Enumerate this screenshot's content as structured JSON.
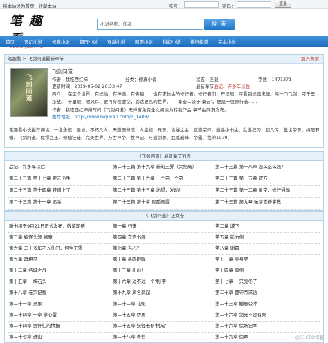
{
  "topbar": {
    "links": [
      "将本站设为首页",
      "收藏本站"
    ],
    "account_label": "账号：",
    "password_label": "密码：",
    "login_button": "登录"
  },
  "logo": {
    "text": "笔 趣 看",
    "domain": "www.biqukan.com"
  },
  "search": {
    "placeholder": "小说名称、作者",
    "button": "搜 索"
  },
  "nav": [
    "首页",
    "玄幻小说",
    "修真小说",
    "都市小说",
    "穿越小说",
    "网游小说",
    "科幻小说",
    "排行榜单",
    "完本小说"
  ],
  "breadcrumb": {
    "home": "笔趣看",
    "sep": " > ",
    "current": "飞剑问道最新章节",
    "add_bookshelf": "加入书架"
  },
  "book": {
    "title": "飞剑问道",
    "cover_text": "飞剑问道",
    "author": "作者：我吃西红柿",
    "category": "分类：修真小说",
    "status": "状态：连载",
    "words": "字数：1471371",
    "updated": "更新时间：2019-05-02 20:33:47",
    "latest_label": "最新章节：",
    "latest": "后记、许多年以后",
    "desc": "简介：　在这个世界，有妖仙，有神魔，有佛祖……也有求长生的修行者。修行者们，开法眼，可看到妖魔鬼怪。练一口飞剑，可千里杀敌。　千里眼、顺风耳、更可穿梭虚空，到达更高的世界。　　秦宏二公子‘秦云’，便是一位修行者……",
    "intro_line1": "作者：我吃西红柿所写的《飞剑问道》无弹窗免费全文阅读为转载作品,章节由网友发布。",
    "intro_line2": "推荐地址：http://www.biqukan.com/1_1408/"
  },
  "related": "笔趣看小说推荐阅读：一念永恒、圣墟、不朽凡人、天道图书馆、人皇纪、元尊、诡秘之主、武道宗师、逍遥小书生、乱世狂刀、超凡传、盖世帝尊、纯阳邪僧、飞剑问道、保镖之王、修仙狂徒、完美世界、万古神帝、牧神记、万道剑尊、武炼巅峰、帝霸、我的1979、",
  "latest_section": {
    "title": "《飞剑问道》最新章节列表",
    "rows": [
      [
        "后记、许多年以后",
        "第二十三篇 第十九章 新的三界（大结局）",
        "第二十三篇 第十八章 怎么这么强？"
      ],
      [
        "第二十三篇 第十七章 要云出手",
        "第二十三篇 第十六章 一个弟一个弟",
        "第二十三篇 第十五章 双方"
      ],
      [
        "第二十三篇 第十四章 铁道上了",
        "第二十三篇 第十三章 坊望，发动！",
        "第二十三篇 第十二章 星空，修行通局"
      ],
      [
        "第二十三篇 第十一章 追杀",
        "第二十三篇 第十章 星孤离雷",
        "第二十三篇 第九章 破涉宫新掌教"
      ]
    ]
  },
  "main_section": {
    "title": "《飞剑问道》正文卷",
    "rows": [
      [
        "新书将于9月21日正式发布，敬请期待！",
        "第一章 归来",
        "第二章 城下"
      ],
      [
        "第三章 妖怪头领 猪魔",
        "第四章 东宫书阁",
        "第五章 新力剑"
      ],
      [
        "第六章 二十多年不入仙门，何生无望",
        "第七章 当心？",
        "第八章 谢霜"
      ],
      [
        "第九章 再相见",
        "第十章 杀鸣眼眸",
        "第十一章 卖身契"
      ],
      [
        "第十二章 名城之战",
        "第十三章 出山！",
        "第十四章 离剑"
      ],
      [
        "第十五章 一块石头",
        "第十六章 过不过一个'利'字",
        "第十七章 一只亮冬子"
      ],
      [
        "第十八章 卷宗记载",
        "第十九章 声名鹊起",
        "第二十章 都守帝求访"
      ],
      [
        "第二十一章 灵果",
        "第二十二章 花魁",
        "第二十三章 触怒公冲"
      ],
      [
        "第二十四章 一章 掌心雷",
        "第二十五章 伊勇",
        "第二十六章 剑光不容有失"
      ],
      [
        "第二十四章 贾怀仁的情报",
        "第二十五章 妖怪老仆'桃成'",
        "第二十六章 伏妖记本"
      ],
      [
        "第二十七章 进山",
        "第二十八章 寄信",
        "第二十九章 伪命"
      ]
    ]
  },
  "watermark": "@51CTO博客"
}
